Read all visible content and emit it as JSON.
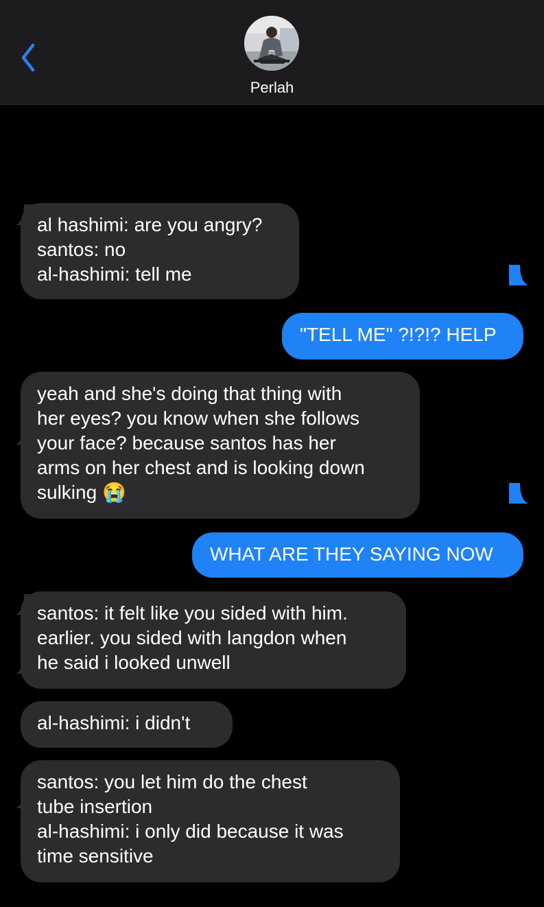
{
  "header": {
    "contact_name": "Perlah",
    "back_icon": "chevron-left-icon",
    "avatar": "contact-avatar"
  },
  "colors": {
    "background": "#000000",
    "header_background": "#1c1c1e",
    "incoming_bubble": "#2c2c2e",
    "outgoing_bubble": "#1f82f7",
    "accent": "#2f7ef0"
  },
  "messages": [
    {
      "direction": "incoming",
      "text": "al hashimi: are you angry?\nsantos: no\nal-hashimi: tell me"
    },
    {
      "direction": "outgoing",
      "text": "\"TELL ME\" ?!?!? HELP"
    },
    {
      "direction": "incoming",
      "text": "yeah and she's doing that thing with\nher eyes? you know when she follows\nyour face? because santos has her\narms on her chest and is looking down\nsulking 😭"
    },
    {
      "direction": "outgoing",
      "text": "WHAT ARE THEY SAYING NOW"
    },
    {
      "direction": "incoming",
      "text": "santos: it felt like you sided with him.\nearlier. you sided with langdon when\nhe said i looked unwell"
    },
    {
      "direction": "incoming",
      "text": "al-hashimi: i didn't"
    },
    {
      "direction": "incoming",
      "text": "santos: you let him do the chest\ntube insertion\nal-hashimi: i only did because it was\ntime sensitive"
    }
  ]
}
